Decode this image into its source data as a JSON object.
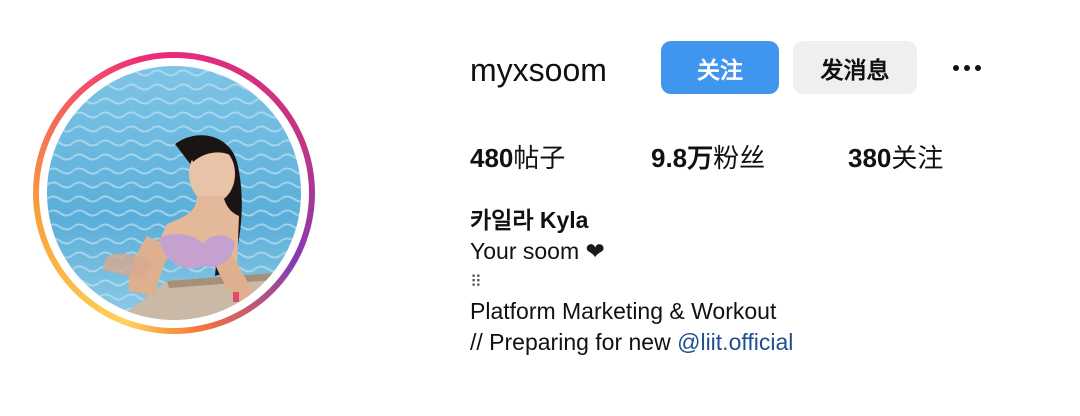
{
  "profile": {
    "username": "myxsoom",
    "follow_label": "关注",
    "message_label": "发消息"
  },
  "stats": {
    "posts_count": "480",
    "posts_label": "帖子",
    "followers_count": "9.8万",
    "followers_label": "粉丝",
    "following_count": "380",
    "following_label": "关注"
  },
  "bio": {
    "display_name": "카일라 Kyla",
    "line1_text": "Your soom ",
    "line1_heart": "❤",
    "line2": "⠿",
    "line3": "Platform Marketing & Workout",
    "line4_prefix": "// Preparing for new ",
    "line4_mention": "@liit.official"
  },
  "colors": {
    "follow_button": "#4096ee",
    "message_button": "#efefef",
    "mention_link": "#1f4f8f"
  },
  "icons": {
    "more": "more-horizontal-icon"
  }
}
